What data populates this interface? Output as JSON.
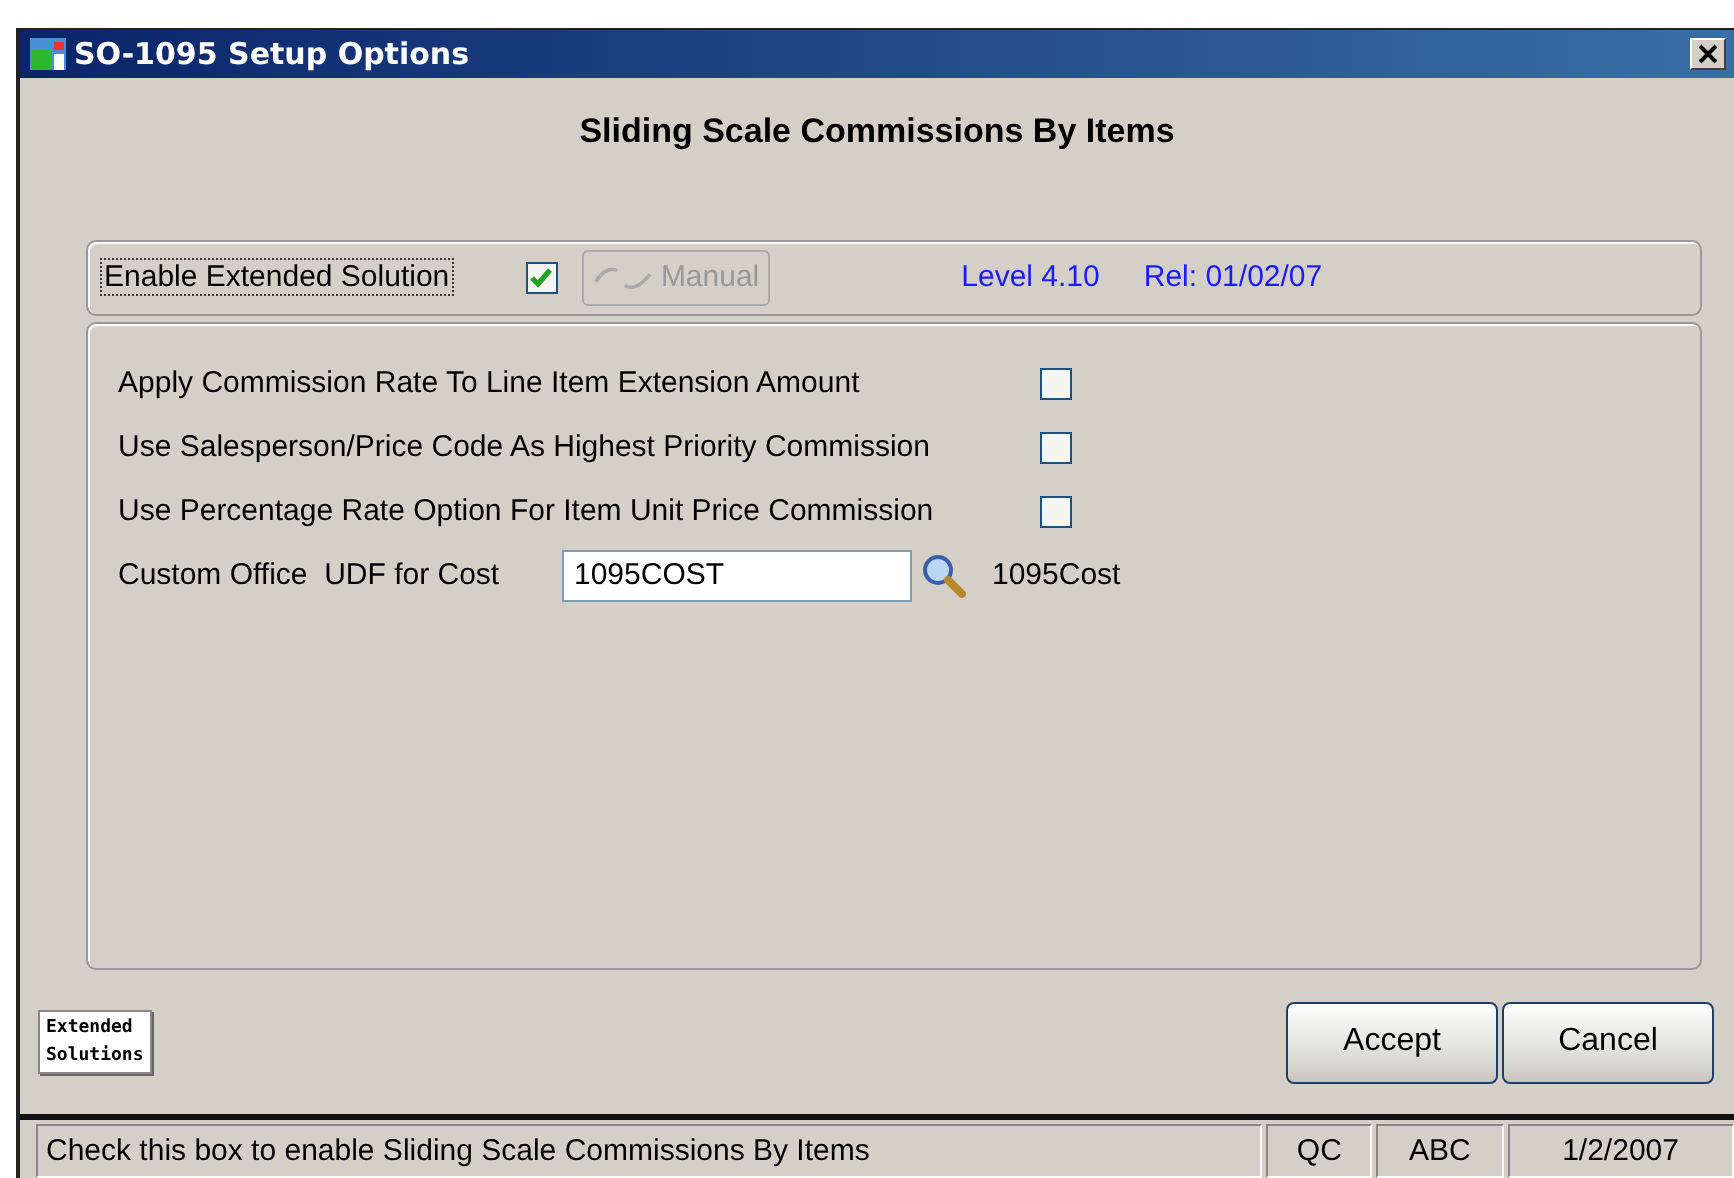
{
  "window": {
    "title": "SO-1095 Setup Options"
  },
  "heading": "Sliding Scale Commissions By Items",
  "enable": {
    "label": "Enable Extended Solution",
    "checked": true,
    "manual_button": {
      "label": "Manual",
      "disabled": true
    },
    "level": "Level 4.10",
    "release": "Rel: 01/02/07"
  },
  "options": [
    {
      "label": "Apply Commission Rate To Line Item Extension Amount",
      "checked": false
    },
    {
      "label": "Use Salesperson/Price Code As Highest Priority Commission",
      "checked": false
    },
    {
      "label": "Use Percentage Rate Option For Item Unit Price Commission",
      "checked": false
    }
  ],
  "udf": {
    "label": "Custom Office  UDF for Cost",
    "value": "1095COST",
    "description": "1095Cost"
  },
  "logo": [
    "Extended",
    "Solutions"
  ],
  "buttons": [
    "Accept",
    "Cancel"
  ],
  "status_bar": {
    "message": "Check this box to enable Sliding Scale Commissions By Items",
    "panels": [
      "QC",
      "ABC",
      "1/2/2007"
    ]
  }
}
